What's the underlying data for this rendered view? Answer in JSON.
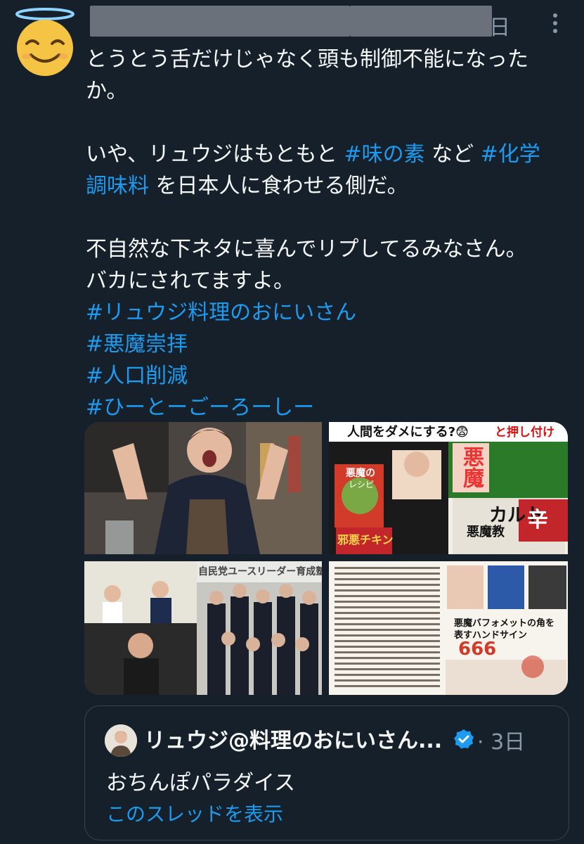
{
  "post": {
    "author_avatar_icon": "smiling-face-with-halo-icon",
    "date_fragment": "日",
    "more_icon": "more-vertical-icon",
    "lines": [
      "とうとう舌だけじゃなく頭も制御不能になった",
      "か。",
      "",
      "いや、リュウジはもともと",
      "調味料",
      "",
      "不自然な下ネタに喜んでリプしてるみなさん。",
      "バカにされてますよ。"
    ],
    "frag_line4_tag1": "#味の素",
    "frag_line4_mid": " など ",
    "frag_line4_tag2": "#化学",
    "frag_line5_rest": " を日本人に食わせる側だ。",
    "hashtags": [
      "#リュウジ料理のおにいさん",
      "#悪魔崇拝",
      "#人口削減",
      "#ひーとーごーろーしー"
    ]
  },
  "media": {
    "tile2_title": "人間をダメにする?😨",
    "tile2_tag": "と押し付け",
    "tile2_words": [
      "悪魔",
      "カルト",
      "悪魔教",
      "悪魔の",
      "邪悪チキン",
      "レシピ",
      "辛"
    ],
    "tile3_banner": "自民党ユースリーダー育成塾",
    "tile4_caption": "悪魔バフォメットの角を表すハンドサイン",
    "tile4_numbers": "666"
  },
  "quote": {
    "name": "リュウジ@料理のおにいさん...",
    "verified_icon": "verified-badge-icon",
    "date": "· 3日",
    "text": "おちんぽパラダイス",
    "show_thread": "このスレッドを表示"
  },
  "colors": {
    "background": "#15202b",
    "text": "#f7f9f9",
    "secondary": "#8b98a5",
    "link": "#1d9bf0",
    "border": "#38444d"
  }
}
